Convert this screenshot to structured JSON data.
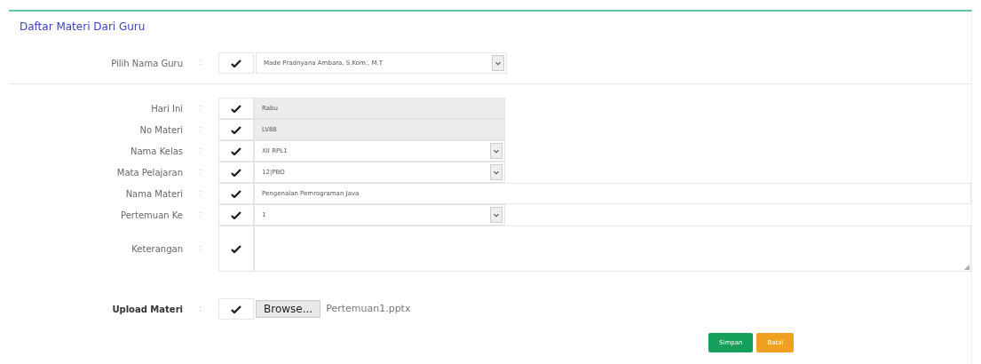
{
  "title": "Daftar Materi Dari Guru",
  "teacher": {
    "label": "Pilih Nama Guru",
    "separator": ":",
    "value": "Made Pradnyana Ambara, S.Kom., M.T"
  },
  "fields": [
    {
      "kind": "readonly",
      "label": "Hari Ini",
      "separator": ":",
      "value": "Rabu"
    },
    {
      "kind": "readonly",
      "label": "No Materi",
      "separator": ":",
      "value": "LV88"
    },
    {
      "kind": "select",
      "label": "Nama Kelas",
      "separator": ":",
      "value": "XII RPL1"
    },
    {
      "kind": "select",
      "label": "Mata Pelajaran",
      "separator": ":",
      "value": "12|PBO"
    },
    {
      "kind": "text",
      "label": "Nama Materi",
      "separator": ":",
      "value": "Pengenalan Pemrograman Java"
    },
    {
      "kind": "select",
      "label": "Pertemuan Ke",
      "separator": ":",
      "value": "1"
    },
    {
      "kind": "textarea",
      "label": "Keterangan",
      "separator": ":"
    }
  ],
  "upload": {
    "label": "Upload Materi",
    "separator": ":",
    "button": "Browse...",
    "file": "Pertemuan1.pptx"
  },
  "buttons": [
    {
      "kind": "primary",
      "label": "Simpan"
    },
    {
      "kind": "warning",
      "label": "Batal"
    }
  ]
}
